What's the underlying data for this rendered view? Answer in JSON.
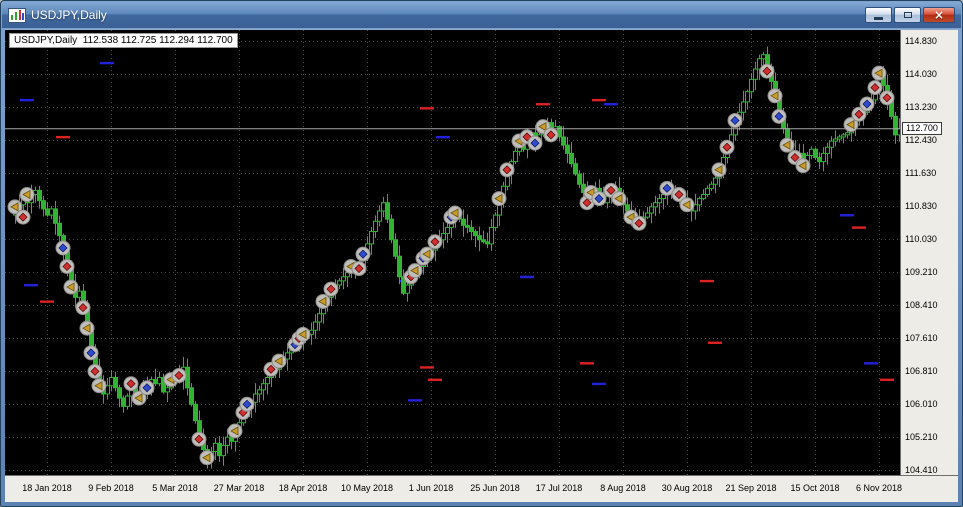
{
  "window": {
    "title": "USDJPY,Daily",
    "close_glyph": "×",
    "controls": [
      "minimize",
      "restore",
      "close"
    ]
  },
  "chart": {
    "info_label": "USDJPY,Daily  112.538 112.725 112.294 112.700",
    "bid_label": "112.700"
  },
  "chart_data": {
    "type": "candlestick",
    "title": "USDJPY, Daily",
    "symbol": "USDJPY",
    "timeframe": "Daily",
    "quote_open": 112.538,
    "quote_high": 112.725,
    "quote_low": 112.294,
    "quote_close": 112.7,
    "bid": 112.7,
    "ylim": [
      104.28,
      115.1
    ],
    "grid": true,
    "legend": "none",
    "y_tick_labels": [
      "114.830",
      "114.030",
      "113.230",
      "112.430",
      "111.630",
      "110.830",
      "110.030",
      "109.210",
      "108.410",
      "107.610",
      "106.810",
      "106.010",
      "105.210",
      "104.410"
    ],
    "x_tick_labels": [
      "18 Jan 2018",
      "9 Feb 2018",
      "5 Mar 2018",
      "27 Mar 2018",
      "18 Apr 2018",
      "10 May 2018",
      "1 Jun 2018",
      "25 Jun 2018",
      "17 Jul 2018",
      "8 Aug 2018",
      "30 Aug 2018",
      "21 Sep 2018",
      "15 Oct 2018",
      "6 Nov 2018"
    ],
    "x_tick_first_bar": 8,
    "x_tick_step": 16,
    "first_open": 110.6,
    "closes": [
      110.7,
      110.85,
      111.0,
      110.9,
      111.1,
      111.2,
      110.95,
      110.75,
      110.6,
      110.75,
      110.4,
      110.1,
      109.7,
      109.3,
      108.9,
      108.6,
      108.75,
      108.3,
      107.8,
      107.3,
      106.85,
      106.55,
      106.25,
      106.45,
      106.65,
      106.4,
      106.15,
      105.95,
      106.2,
      106.45,
      106.3,
      106.25,
      106.45,
      106.3,
      106.6,
      106.5,
      106.65,
      106.3,
      106.4,
      106.55,
      106.75,
      106.6,
      106.9,
      106.4,
      106.0,
      105.6,
      105.2,
      104.9,
      104.65,
      104.85,
      105.05,
      104.75,
      105.0,
      105.2,
      105.1,
      105.3,
      105.55,
      105.7,
      105.9,
      106.05,
      106.25,
      106.35,
      106.5,
      106.65,
      106.8,
      106.85,
      107.0,
      107.1,
      107.25,
      107.3,
      107.4,
      107.5,
      107.65,
      107.7,
      107.8,
      108.0,
      108.2,
      108.45,
      108.6,
      108.75,
      108.9,
      109.0,
      109.1,
      109.2,
      109.3,
      109.25,
      109.35,
      109.6,
      109.9,
      110.2,
      110.45,
      110.7,
      110.9,
      110.5,
      110.0,
      109.6,
      109.1,
      108.7,
      108.9,
      109.05,
      109.2,
      109.35,
      109.5,
      109.6,
      109.75,
      109.9,
      110.0,
      110.15,
      110.3,
      110.5,
      110.6,
      110.5,
      110.35,
      110.3,
      110.2,
      110.1,
      110.0,
      109.95,
      109.9,
      110.3,
      110.6,
      110.95,
      111.3,
      111.6,
      111.9,
      112.15,
      112.35,
      112.2,
      112.45,
      112.6,
      112.4,
      112.55,
      112.7,
      112.85,
      112.6,
      112.75,
      112.5,
      112.3,
      112.1,
      111.85,
      111.6,
      111.35,
      111.15,
      110.95,
      111.1,
      111.25,
      111.05,
      110.9,
      111.05,
      111.15,
      111.25,
      111.05,
      110.85,
      110.7,
      110.6,
      110.5,
      110.45,
      110.55,
      110.65,
      110.8,
      110.9,
      111.0,
      111.1,
      111.15,
      111.2,
      111.1,
      111.05,
      110.95,
      110.8,
      110.7,
      110.85,
      111.0,
      111.1,
      111.25,
      111.35,
      111.5,
      111.6,
      112.0,
      112.3,
      112.55,
      112.8,
      113.1,
      113.35,
      113.6,
      113.9,
      114.15,
      114.4,
      114.5,
      114.2,
      113.85,
      113.45,
      113.05,
      112.7,
      112.4,
      112.15,
      111.95,
      112.1,
      111.9,
      112.05,
      112.2,
      112.0,
      111.9,
      112.1,
      112.25,
      112.4,
      112.45,
      112.5,
      112.55,
      112.6,
      112.75,
      112.9,
      113.0,
      113.1,
      113.25,
      113.4,
      113.7,
      114.0,
      113.75,
      113.4,
      113.0,
      112.55,
      112.7
    ],
    "marker_types": {
      "ya": "yellow-left-arrow",
      "rd": "red-diamond",
      "bd": "blue-diamond"
    },
    "markers": [
      [
        0,
        110.8,
        "ya"
      ],
      [
        2,
        110.55,
        "rd"
      ],
      [
        3,
        111.1,
        "ya"
      ],
      [
        12,
        109.8,
        "bd"
      ],
      [
        13,
        109.35,
        "rd"
      ],
      [
        14,
        108.85,
        "ya"
      ],
      [
        17,
        108.35,
        "rd"
      ],
      [
        18,
        107.85,
        "ya"
      ],
      [
        19,
        107.25,
        "bd"
      ],
      [
        20,
        106.8,
        "rd"
      ],
      [
        21,
        106.45,
        "ya"
      ],
      [
        29,
        106.5,
        "rd"
      ],
      [
        31,
        106.15,
        "ya"
      ],
      [
        33,
        106.4,
        "bd"
      ],
      [
        39,
        106.6,
        "ya"
      ],
      [
        41,
        106.7,
        "rd"
      ],
      [
        46,
        105.15,
        "rd"
      ],
      [
        48,
        104.7,
        "ya"
      ],
      [
        55,
        105.35,
        "ya"
      ],
      [
        57,
        105.8,
        "rd"
      ],
      [
        58,
        106.0,
        "bd"
      ],
      [
        64,
        106.85,
        "rd"
      ],
      [
        66,
        107.05,
        "ya"
      ],
      [
        70,
        107.45,
        "bd"
      ],
      [
        71,
        107.6,
        "rd"
      ],
      [
        72,
        107.7,
        "ya"
      ],
      [
        77,
        108.5,
        "ya"
      ],
      [
        79,
        108.8,
        "rd"
      ],
      [
        84,
        109.35,
        "ya"
      ],
      [
        86,
        109.3,
        "rd"
      ],
      [
        87,
        109.65,
        "bd"
      ],
      [
        99,
        109.1,
        "rd"
      ],
      [
        100,
        109.25,
        "ya"
      ],
      [
        102,
        109.55,
        "bd"
      ],
      [
        103,
        109.65,
        "ya"
      ],
      [
        105,
        109.95,
        "rd"
      ],
      [
        109,
        110.55,
        "bd"
      ],
      [
        110,
        110.65,
        "ya"
      ],
      [
        121,
        111.0,
        "ya"
      ],
      [
        123,
        111.7,
        "rd"
      ],
      [
        126,
        112.4,
        "ya"
      ],
      [
        128,
        112.5,
        "rd"
      ],
      [
        130,
        112.35,
        "bd"
      ],
      [
        132,
        112.75,
        "ya"
      ],
      [
        134,
        112.55,
        "rd"
      ],
      [
        143,
        110.9,
        "rd"
      ],
      [
        144,
        111.15,
        "ya"
      ],
      [
        146,
        111.0,
        "bd"
      ],
      [
        149,
        111.2,
        "rd"
      ],
      [
        151,
        111.0,
        "ya"
      ],
      [
        154,
        110.55,
        "ya"
      ],
      [
        156,
        110.4,
        "rd"
      ],
      [
        163,
        111.25,
        "bd"
      ],
      [
        166,
        111.1,
        "rd"
      ],
      [
        168,
        110.85,
        "ya"
      ],
      [
        176,
        111.7,
        "ya"
      ],
      [
        178,
        112.25,
        "rd"
      ],
      [
        180,
        112.9,
        "bd"
      ],
      [
        188,
        114.1,
        "rd"
      ],
      [
        190,
        113.5,
        "ya"
      ],
      [
        191,
        113.0,
        "bd"
      ],
      [
        193,
        112.3,
        "ya"
      ],
      [
        195,
        112.0,
        "rd"
      ],
      [
        197,
        111.8,
        "ya"
      ],
      [
        209,
        112.8,
        "ya"
      ],
      [
        211,
        113.05,
        "rd"
      ],
      [
        213,
        113.3,
        "bd"
      ],
      [
        215,
        113.7,
        "rd"
      ],
      [
        216,
        114.05,
        "ya"
      ],
      [
        218,
        113.45,
        "rd"
      ]
    ],
    "level_dashes": [
      [
        3,
        113.4,
        "b"
      ],
      [
        4,
        108.9,
        "b"
      ],
      [
        8,
        108.5,
        "r"
      ],
      [
        12,
        112.5,
        "r"
      ],
      [
        23,
        114.3,
        "b"
      ],
      [
        98,
        109.0,
        "b"
      ],
      [
        100,
        106.1,
        "b"
      ],
      [
        103,
        113.2,
        "r"
      ],
      [
        103,
        106.9,
        "r"
      ],
      [
        105,
        106.6,
        "r"
      ],
      [
        107,
        112.5,
        "b"
      ],
      [
        128,
        109.1,
        "b"
      ],
      [
        132,
        113.3,
        "r"
      ],
      [
        143,
        107.0,
        "r"
      ],
      [
        146,
        106.5,
        "b"
      ],
      [
        146,
        113.4,
        "r"
      ],
      [
        149,
        113.3,
        "b"
      ],
      [
        173,
        109.0,
        "r"
      ],
      [
        175,
        107.5,
        "r"
      ],
      [
        208,
        110.6,
        "b"
      ],
      [
        211,
        110.3,
        "r"
      ],
      [
        214,
        107.0,
        "b"
      ],
      [
        218,
        106.6,
        "r"
      ]
    ],
    "colors": {
      "background": "#000000",
      "candle": "#32b332",
      "grid": "#4d4d4d",
      "bid_line": "#a8a8a8",
      "marker_circle": "#bfbebb",
      "marker_circle_edge": "#8e8d8a",
      "arrow_gold": "#c89b2a",
      "diamond_red": "#cf2f2f",
      "diamond_blue": "#2f49cf",
      "dash_red": "#dd2222",
      "dash_blue": "#2222dd",
      "axis_background": "#eeece6",
      "titlebar_blue": "#41699e"
    }
  }
}
